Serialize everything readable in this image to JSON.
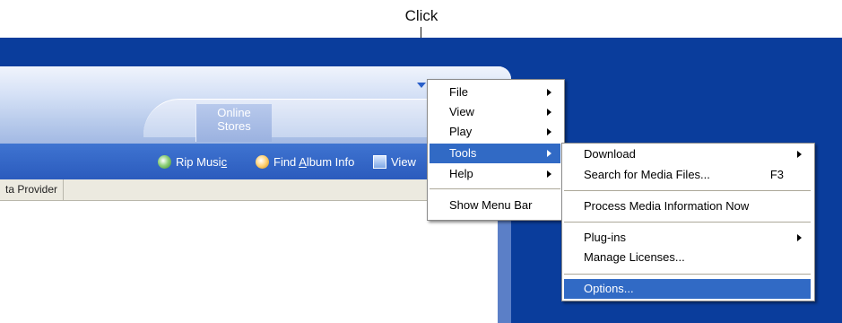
{
  "annotation": {
    "text": "Click"
  },
  "player": {
    "tab_online_line1": "Online",
    "tab_online_line2": "Stores",
    "toolbar": {
      "rip_prefix": "Rip Musi",
      "rip_u": "c",
      "rip_suffix": "",
      "find_prefix": "Find ",
      "find_u": "A",
      "find_suffix": "lbum Info",
      "view_label": "View"
    },
    "column_header": "ta Provider"
  },
  "main_menu": {
    "items": [
      {
        "label": "File",
        "has_submenu": true
      },
      {
        "label": "View",
        "has_submenu": true
      },
      {
        "label": "Play",
        "has_submenu": true
      },
      {
        "label": "Tools",
        "has_submenu": true,
        "selected": true
      },
      {
        "label": "Help",
        "has_submenu": true
      },
      {
        "label": "Show Menu Bar",
        "has_submenu": false
      }
    ]
  },
  "tools_submenu": {
    "items": [
      {
        "label": "Download",
        "has_submenu": true
      },
      {
        "label": "Search for Media Files...",
        "shortcut": "F3"
      },
      {
        "label": "Process Media Information Now"
      },
      {
        "label": "Plug-ins",
        "has_submenu": true
      },
      {
        "label": "Manage Licenses..."
      },
      {
        "label": "Options...",
        "selected": true
      }
    ]
  },
  "colors": {
    "desktop": "#0a3d9c",
    "menu_highlight": "#316ac5",
    "toolbar": "#2b5bbd"
  }
}
